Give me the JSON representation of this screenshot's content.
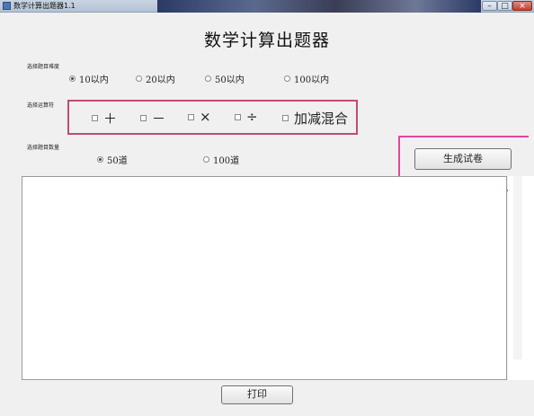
{
  "window": {
    "title": "数学计算出题器1.1",
    "controls": {
      "min": "–",
      "max": "□",
      "close": "×"
    }
  },
  "app_title": "数学计算出题器",
  "range": {
    "label": "选择题目难度",
    "options": [
      "10以内",
      "20以内",
      "50以内",
      "100以内"
    ],
    "selected": "10以内"
  },
  "operators": {
    "label": "选择运算符",
    "options": [
      "＋",
      "－",
      "×",
      "÷",
      "加减混合"
    ],
    "checked": []
  },
  "count": {
    "label": "选择题目数量",
    "options": [
      "50道",
      "100道"
    ],
    "selected": "50道"
  },
  "buttons": {
    "generate": "生成试卷",
    "print": "打印"
  },
  "output": {
    "text": ""
  },
  "colors": {
    "highlight_operator_box": "#c04b72",
    "highlight_generate_box": "#e1479d",
    "window_bg": "#f0f0f0"
  }
}
